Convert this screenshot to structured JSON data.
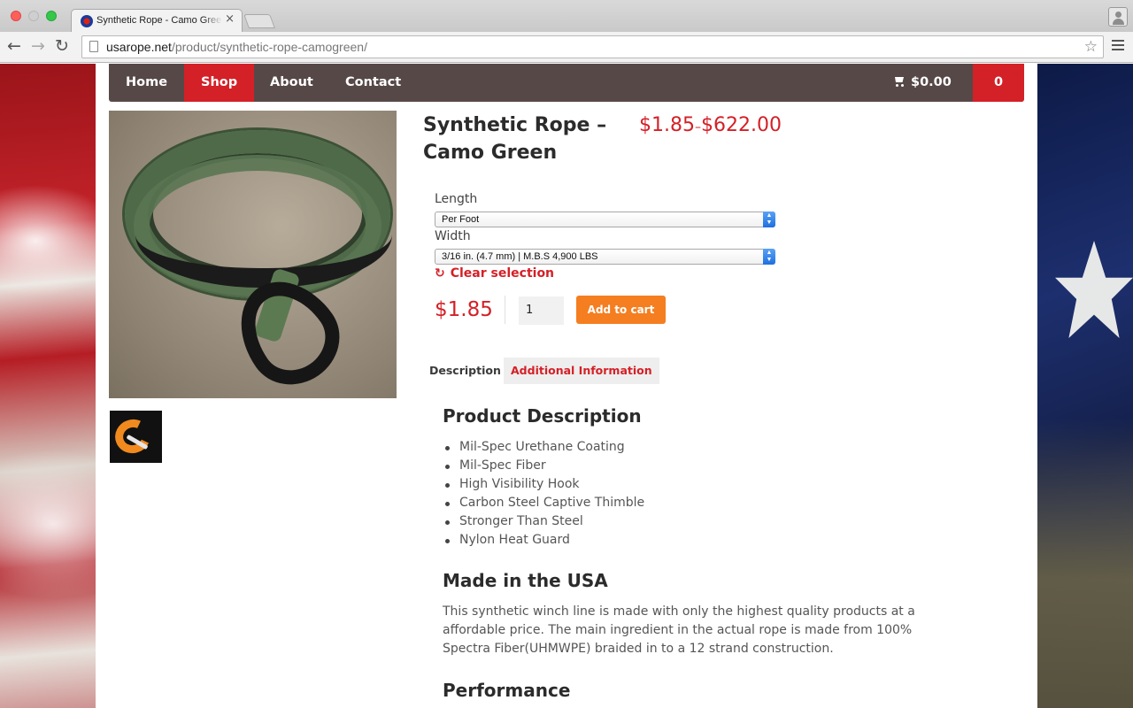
{
  "browser": {
    "tab_title": "Synthetic Rope - Camo Green",
    "tab_close": "×",
    "url_host": "usarope.net",
    "url_path": "/product/synthetic-rope-camogreen/"
  },
  "nav": {
    "items": [
      "Home",
      "Shop",
      "About",
      "Contact"
    ],
    "active": "Shop",
    "cart_total": "$0.00",
    "cart_count": "0"
  },
  "product": {
    "title": "Synthetic Rope – Camo Green",
    "price_min": "$1.85",
    "price_sep": "–",
    "price_max": "$622.00",
    "length_label": "Length",
    "length_value": "Per Foot",
    "width_label": "Width",
    "width_value": "3/16 in. (4.7 mm) | M.B.S 4,900 LBS",
    "clear_selection": "Clear selection",
    "variation_price": "$1.85",
    "quantity": "1",
    "add_to_cart": "Add to cart"
  },
  "tabs": {
    "description": "Description",
    "additional": "Additional Information"
  },
  "description": {
    "heading": "Product Description",
    "features": [
      "Mil-Spec Urethane Coating",
      "Mil-Spec Fiber",
      "High Visibility Hook",
      "Carbon Steel Captive Thimble",
      "Stronger Than Steel",
      "Nylon Heat Guard"
    ],
    "made_heading": "Made in the USA",
    "made_text": "This synthetic winch line is made with only the highest quality products at a affordable price. The main ingredient in the actual rope is made from 100% Spectra Fiber(UHMWPE) braided in to a 12 strand construction.",
    "performance_heading": "Performance"
  },
  "colors": {
    "brand_red": "#d42027",
    "nav_bg": "#574848",
    "cart_button": "#f47e20"
  }
}
